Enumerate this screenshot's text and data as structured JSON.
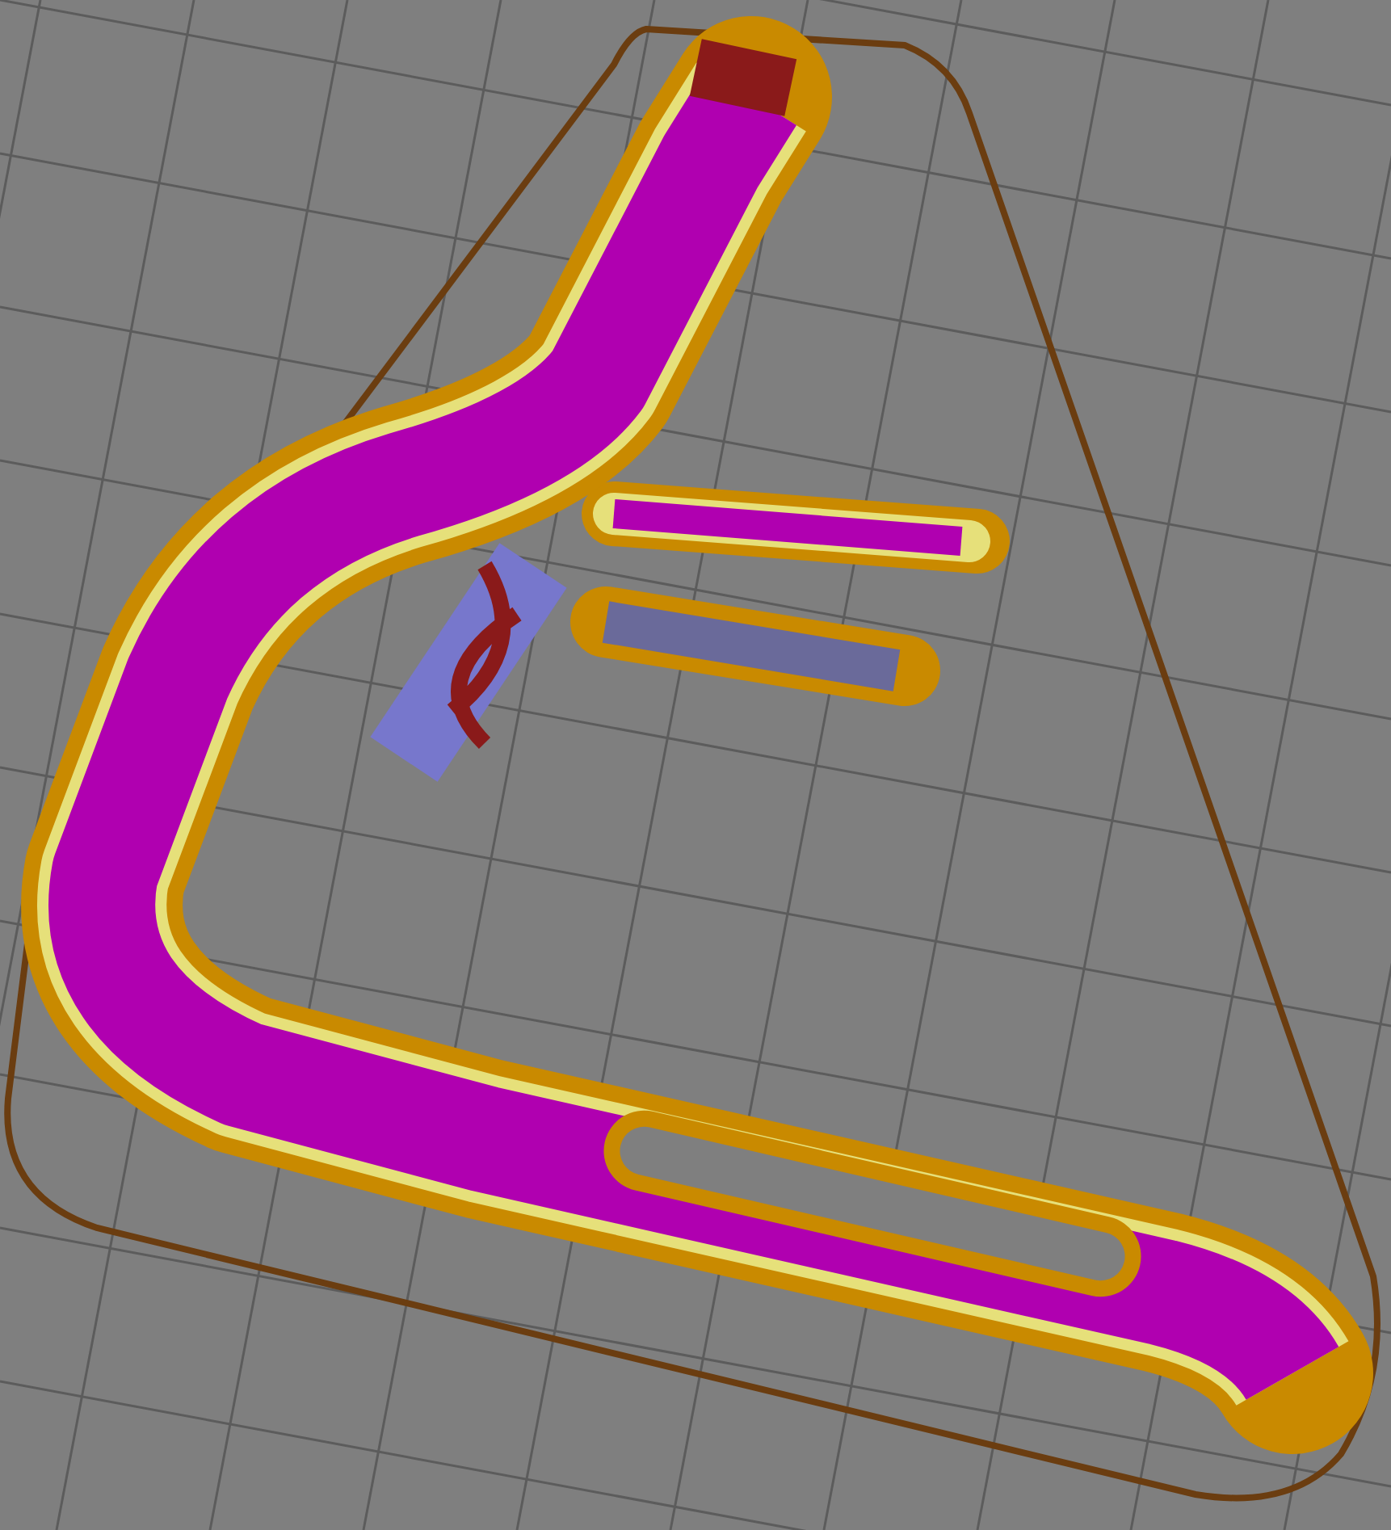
{
  "viewport": {
    "kind": "toolpath-preview",
    "show_skirt": true
  }
}
